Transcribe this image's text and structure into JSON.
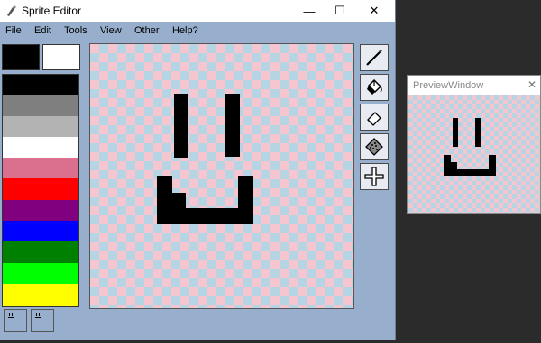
{
  "window": {
    "title": "Sprite Editor",
    "minimize": "—",
    "maximize": "☐",
    "close": "✕"
  },
  "menu": [
    "File",
    "Edit",
    "Tools",
    "View",
    "Other",
    "Help?"
  ],
  "colors": {
    "foreground": "#000000",
    "background": "#ffffff",
    "palette": [
      "#000000",
      "#7f7f7f",
      "#b3b3b3",
      "#ffffff",
      "#db6f8e",
      "#ff0000",
      "#800080",
      "#0000ff",
      "#008000",
      "#00ff00",
      "#ffff00"
    ]
  },
  "tools": [
    "brush-icon",
    "bucket-fill-icon",
    "eraser-icon",
    "spray-icon",
    "move-crosshair-icon"
  ],
  "preview": {
    "title": "PreviewWindow",
    "close": "✕"
  }
}
